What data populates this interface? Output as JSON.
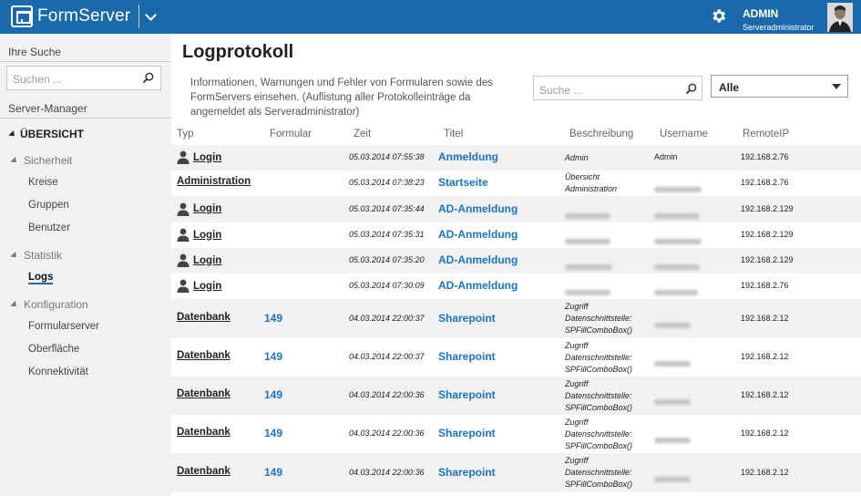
{
  "header": {
    "app_name": "FormServer",
    "user_name": "ADMIN",
    "user_role": "Serveradministrator"
  },
  "sidebar": {
    "search_title": "Ihre Suche",
    "search_placeholder": "Suchen ...",
    "server_manager": "Server-Manager",
    "overview": "ÜBERSICHT",
    "groups": [
      {
        "label": "Sicherheit",
        "items": [
          "Kreise",
          "Gruppen",
          "Benutzer"
        ]
      },
      {
        "label": "Statistik",
        "items": [
          "Logs"
        ]
      },
      {
        "label": "Konfiguration",
        "items": [
          "Formularserver",
          "Oberfläche",
          "Konnektivität"
        ]
      }
    ],
    "active_item": "Logs"
  },
  "main": {
    "title": "Logprotokoll",
    "description": "Informationen, Warnungen und Fehler von Formularen sowie des FormServers einsehen. (Auflistung aller Protokolleinträge da angemeldet als Serveradministrator)",
    "search_placeholder": "Suche ...",
    "filter_value": "Alle"
  },
  "table": {
    "columns": [
      "Typ",
      "Formular",
      "Zeit",
      "Titel",
      "Beschreibung",
      "Username",
      "RemoteIP"
    ],
    "rows": [
      {
        "typ": "Login",
        "icon": "user-icon",
        "formular": "",
        "zeit": "05.03.2014 07:55:38",
        "titel": "Anmeldung",
        "beschreibung": "Admin",
        "username": "Admin",
        "ip": "192.168.2.76"
      },
      {
        "typ": "Administration",
        "icon": "",
        "formular": "",
        "zeit": "05.03.2014 07:38:23",
        "titel": "Startseite",
        "beschreibung": "Übersicht Administration",
        "username": "",
        "ip": "192.168.2.76"
      },
      {
        "typ": "Login",
        "icon": "user-icon",
        "formular": "",
        "zeit": "05.03.2014 07:35:44",
        "titel": "AD-Anmeldung",
        "beschreibung": "",
        "username": "",
        "ip": "192.168.2.129"
      },
      {
        "typ": "Login",
        "icon": "user-icon",
        "formular": "",
        "zeit": "05.03.2014 07:35:31",
        "titel": "AD-Anmeldung",
        "beschreibung": "",
        "username": "",
        "ip": "192.168.2.129"
      },
      {
        "typ": "Login",
        "icon": "user-icon",
        "formular": "",
        "zeit": "05.03.2014 07:35:20",
        "titel": "AD-Anmeldung",
        "beschreibung": "",
        "username": "",
        "ip": "192.168.2.129"
      },
      {
        "typ": "Login",
        "icon": "user-icon",
        "formular": "",
        "zeit": "05.03.2014 07:30:09",
        "titel": "AD-Anmeldung",
        "beschreibung": "",
        "username": "",
        "ip": "192.168.2.76"
      },
      {
        "typ": "Datenbank",
        "icon": "",
        "formular": "149",
        "zeit": "04.03.2014 22:00:37",
        "titel": "Sharepoint",
        "beschreibung": "Zugriff Datenschnittstelle: SPFillComboBox()",
        "username": "",
        "ip": "192.168.2.12"
      },
      {
        "typ": "Datenbank",
        "icon": "",
        "formular": "149",
        "zeit": "04.03.2014 22:00:37",
        "titel": "Sharepoint",
        "beschreibung": "Zugriff Datenschnittstelle: SPFillComboBox()",
        "username": "",
        "ip": "192.168.2.12"
      },
      {
        "typ": "Datenbank",
        "icon": "",
        "formular": "149",
        "zeit": "04.03.2014 22:00:36",
        "titel": "Sharepoint",
        "beschreibung": "Zugriff Datenschnittstelle: SPFillComboBox()",
        "username": "",
        "ip": "192.168.2.12"
      },
      {
        "typ": "Datenbank",
        "icon": "",
        "formular": "149",
        "zeit": "04.03.2014 22:00:36",
        "titel": "Sharepoint",
        "beschreibung": "Zugriff Datenschnittstelle: SPFillComboBox()",
        "username": "",
        "ip": "192.168.2.12"
      },
      {
        "typ": "Datenbank",
        "icon": "",
        "formular": "149",
        "zeit": "04.03.2014 22:00:36",
        "titel": "Sharepoint",
        "beschreibung": "Zugriff Datenschnittstelle: SPFillComboBox()",
        "username": "",
        "ip": "192.168.2.12"
      }
    ]
  },
  "colors": {
    "brand": "#1a6aab",
    "link": "#1a74c1"
  }
}
